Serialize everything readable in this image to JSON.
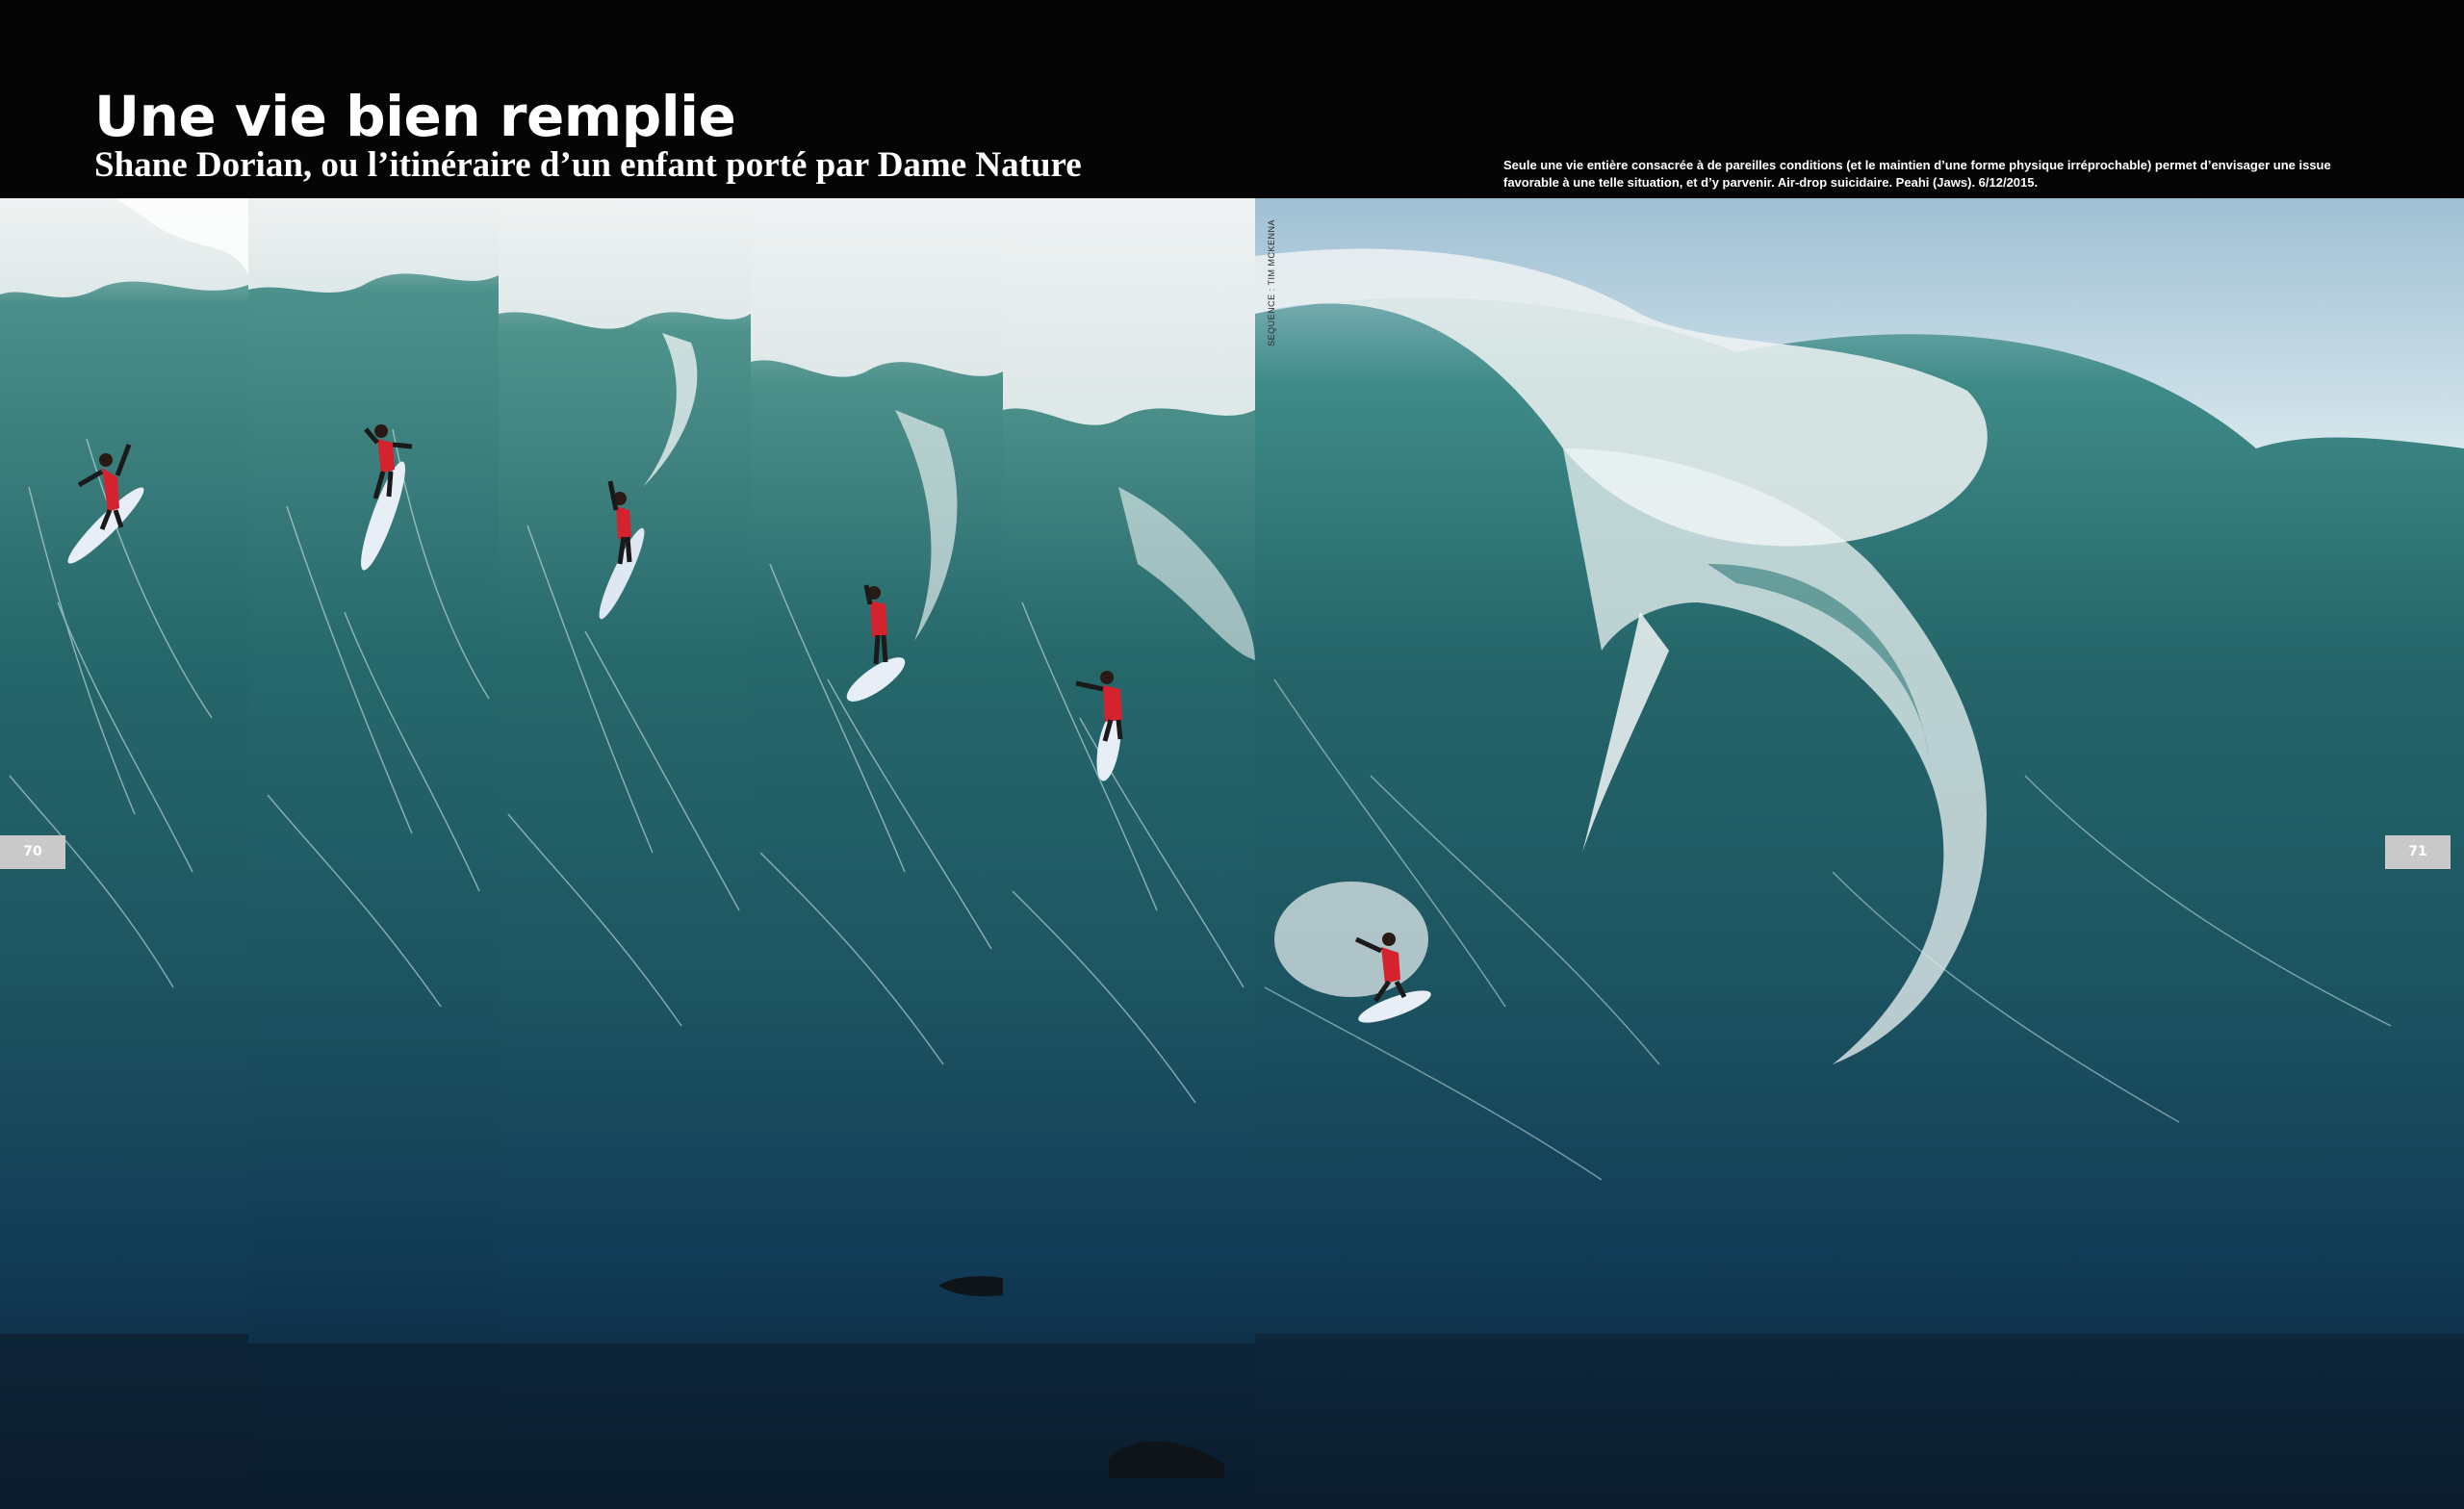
{
  "article": {
    "title": "Une vie bien remplie",
    "subtitle": "Shane Dorian, ou l’itinéraire d’un enfant porté par Dame Nature",
    "caption": "Seule une vie entière consacrée à de pareilles conditions (et le maintien d’une forme physique irréprochable) permet d’envisager une issue favorable à une telle situation, et d’y parvenir. Air-drop suicidaire. Peahi (Jaws). 6/12/2015.",
    "photo_credit": "SEQUENCE : TIM MCKENNA"
  },
  "folios": {
    "left": "70",
    "right": "71"
  },
  "photo_sequence": {
    "frame_count": 6,
    "subject": "surfer on a giant wave"
  },
  "colors": {
    "background": "#050505",
    "title_text": "#ffffff",
    "folio_tab": "#c9c9c9",
    "wave_light": "#3f8b88",
    "wave_mid": "#1f5f65",
    "wave_deep": "#102f45",
    "foam": "#eef2f2",
    "wetsuit": "#d4232f",
    "board": "#e8eef5"
  }
}
